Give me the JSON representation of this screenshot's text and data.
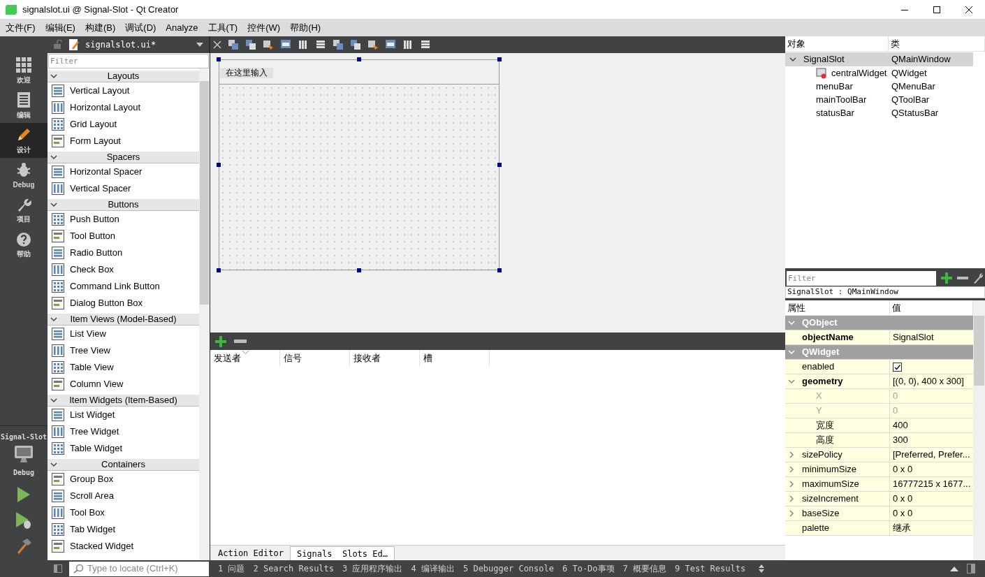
{
  "window": {
    "title": "signalslot.ui @ Signal-Slot - Qt Creator"
  },
  "menu": [
    "文件(F)",
    "编辑(E)",
    "构建(B)",
    "调试(D)",
    "Analyze",
    "工具(T)",
    "控件(W)",
    "帮助(H)"
  ],
  "modes": [
    {
      "label": "欢迎",
      "kind": "welcome",
      "selected": false
    },
    {
      "label": "编辑",
      "kind": "edit",
      "selected": false
    },
    {
      "label": "设计",
      "kind": "design",
      "selected": true
    },
    {
      "label": "Debug",
      "kind": "debug",
      "selected": false
    },
    {
      "label": "项目",
      "kind": "projects",
      "selected": false
    },
    {
      "label": "帮助",
      "kind": "help",
      "selected": false
    }
  ],
  "kit": {
    "project": "Signal-Slot",
    "config": "Debug"
  },
  "editor": {
    "file": "signalslot.ui*"
  },
  "widget_box": {
    "filter_placeholder": "Filter",
    "categories": [
      {
        "title": "Layouts",
        "expanded": true,
        "items": [
          "Vertical Layout",
          "Horizontal Layout",
          "Grid Layout",
          "Form Layout"
        ]
      },
      {
        "title": "Spacers",
        "expanded": true,
        "items": [
          "Horizontal Spacer",
          "Vertical Spacer"
        ]
      },
      {
        "title": "Buttons",
        "expanded": true,
        "items": [
          "Push Button",
          "Tool Button",
          "Radio Button",
          "Check Box",
          "Command Link Button",
          "Dialog Button Box"
        ]
      },
      {
        "title": "Item Views (Model-Based)",
        "expanded": true,
        "items": [
          "List View",
          "Tree View",
          "Table View",
          "Column View"
        ]
      },
      {
        "title": "Item Widgets (Item-Based)",
        "expanded": true,
        "items": [
          "List Widget",
          "Tree Widget",
          "Table Widget"
        ]
      },
      {
        "title": "Containers",
        "expanded": true,
        "items": [
          "Group Box",
          "Scroll Area",
          "Tool Box",
          "Tab Widget",
          "Stacked Widget"
        ]
      }
    ]
  },
  "form": {
    "menu_placeholder": "在这里输入"
  },
  "signal_editor": {
    "columns": [
      "发送者",
      "信号",
      "接收者",
      "槽"
    ],
    "tabs": [
      {
        "label": "Action Editor",
        "selected": false
      },
      {
        "label": "Signals  Slots Ed…",
        "selected": true
      }
    ]
  },
  "object_inspector": {
    "columns": [
      "对象",
      "类"
    ],
    "tree": [
      {
        "name": "SignalSlot",
        "class": "QMainWindow",
        "selected": true,
        "expanded": true,
        "children": [
          {
            "name": "centralWidget",
            "class": "QWidget",
            "selected": false,
            "has_icon": true
          },
          {
            "name": "menuBar",
            "class": "QMenuBar",
            "selected": false,
            "has_icon": false
          },
          {
            "name": "mainToolBar",
            "class": "QToolBar",
            "selected": false,
            "has_icon": false
          },
          {
            "name": "statusBar",
            "class": "QStatusBar",
            "selected": false,
            "has_icon": false
          }
        ]
      }
    ]
  },
  "property_editor": {
    "filter_placeholder": "Filter",
    "object_label": "SignalSlot : QMainWindow",
    "columns": [
      "属性",
      "值"
    ],
    "groups": [
      {
        "name": "QObject",
        "expanded": true,
        "properties": [
          {
            "name": "objectName",
            "value": "SignalSlot",
            "kind": "text",
            "modified": true,
            "expandable": false,
            "expanded": false,
            "disabled": false
          }
        ]
      },
      {
        "name": "QWidget",
        "expanded": true,
        "properties": [
          {
            "name": "enabled",
            "kind": "check",
            "checked": true,
            "modified": false,
            "expandable": false,
            "expanded": false,
            "disabled": false
          },
          {
            "name": "geometry",
            "value": "[(0, 0), 400 x 300]",
            "kind": "text",
            "modified": true,
            "expandable": true,
            "expanded": true,
            "disabled": false,
            "children": [
              {
                "name": "X",
                "value": "0",
                "kind": "text",
                "modified": false,
                "expandable": false,
                "expanded": false,
                "disabled": true
              },
              {
                "name": "Y",
                "value": "0",
                "kind": "text",
                "modified": false,
                "expandable": false,
                "expanded": false,
                "disabled": true
              },
              {
                "name": "宽度",
                "value": "400",
                "kind": "text",
                "modified": false,
                "expandable": false,
                "expanded": false,
                "disabled": false
              },
              {
                "name": "高度",
                "value": "300",
                "kind": "text",
                "modified": false,
                "expandable": false,
                "expanded": false,
                "disabled": false
              }
            ]
          },
          {
            "name": "sizePolicy",
            "value": "[Preferred, Prefer...",
            "kind": "text",
            "modified": false,
            "expandable": true,
            "expanded": false,
            "disabled": false
          },
          {
            "name": "minimumSize",
            "value": "0 x 0",
            "kind": "text",
            "modified": false,
            "expandable": true,
            "expanded": false,
            "disabled": false
          },
          {
            "name": "maximumSize",
            "value": "16777215 x 1677...",
            "kind": "text",
            "modified": false,
            "expandable": true,
            "expanded": false,
            "disabled": false
          },
          {
            "name": "sizeIncrement",
            "value": "0 x 0",
            "kind": "text",
            "modified": false,
            "expandable": true,
            "expanded": false,
            "disabled": false
          },
          {
            "name": "baseSize",
            "value": "0 x 0",
            "kind": "text",
            "modified": false,
            "expandable": true,
            "expanded": false,
            "disabled": false
          },
          {
            "name": "palette",
            "value": "继承",
            "kind": "text",
            "modified": false,
            "expandable": false,
            "expanded": false,
            "disabled": false
          }
        ]
      }
    ]
  },
  "locator": {
    "placeholder": "Type to locate (Ctrl+K)"
  },
  "output_panes": [
    "1 问题",
    "2 Search Results",
    "3 应用程序输出",
    "4 编译输出",
    "5 Debugger Console",
    "6 To-Do事项",
    "7 概要信息",
    "9 Test Results"
  ]
}
